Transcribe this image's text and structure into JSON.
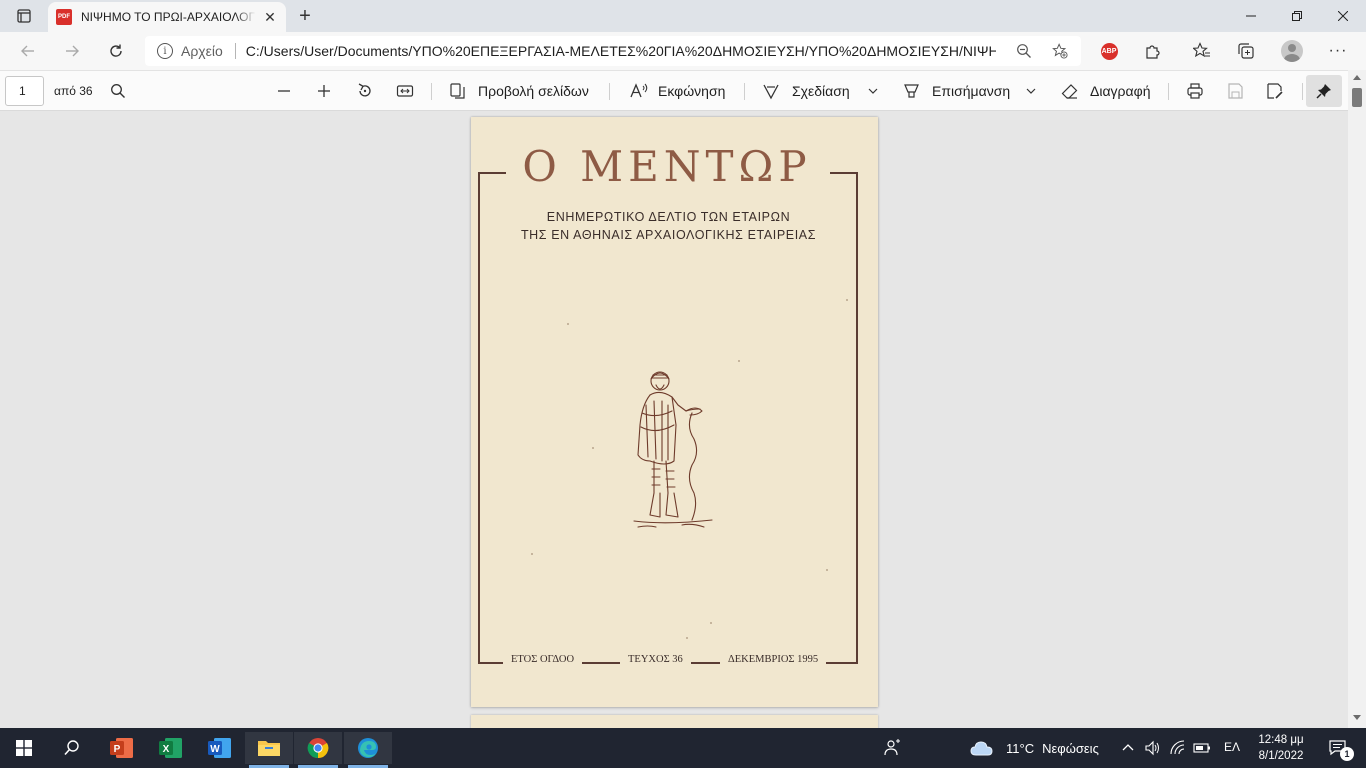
{
  "browser": {
    "tab_title": "ΝΙΨΗΜΟ ΤΟ ΠΡΩΙ-ΑΡΧΑΙΟΛΟΓΙΑ",
    "tab_icon": "pdf-icon",
    "address": {
      "scheme_label": "Αρχείο",
      "url": "C:/Users/User/Documents/ΥΠΟ%20ΕΠΕΞΕΡΓΑΣΙΑ-ΜΕΛΕΤΕΣ%20ΓΙΑ%20ΔΗΜΟΣΙΕΥΣΗ/ΥΠΟ%20ΔΗΜΟΣΙΕΥΣΗ/ΝΙΨΗΜΟ..."
    },
    "extension_badge": "ABP"
  },
  "pdf_toolbar": {
    "page_number": "1",
    "page_count": "από 36",
    "page_view_label": "Προβολή σελίδων",
    "read_aloud_label": "Εκφώνηση",
    "draw_label": "Σχεδίαση",
    "highlight_label": "Επισήμανση",
    "erase_label": "Διαγραφή"
  },
  "document": {
    "cover_title": "Ο ΜΕΝΤΩΡ",
    "subtitle_line1": "ΕΝΗΜΕΡΩΤΙΚΟ ΔΕΛΤΙΟ ΤΩΝ ΕΤΑΙΡΩΝ",
    "subtitle_line2": "ΤΗΣ ΕΝ ΑΘΗΝΑΙΣ ΑΡΧΑΙΟΛΟΓΙΚΗΣ ΕΤΑΙΡΕΙΑΣ",
    "footer_year": "ΕΤΟΣ ΟΓΔΟΟ",
    "footer_issue": "ΤΕΥΧΟΣ 36",
    "footer_date": "ΔΕΚΕΜΒΡΙΟΣ 1995",
    "paper_color": "#f1e7cf",
    "title_color": "#8e5b45"
  },
  "taskbar": {
    "weather_temp": "11°C",
    "weather_desc": "Νεφώσεις",
    "language": "ΕΛ",
    "time": "12:48 μμ",
    "date": "8/1/2022",
    "notification_count": "1",
    "pinned_apps": [
      "powerpoint-icon",
      "excel-icon",
      "word-icon",
      "file-explorer-icon",
      "chrome-icon",
      "edge-icon"
    ]
  }
}
